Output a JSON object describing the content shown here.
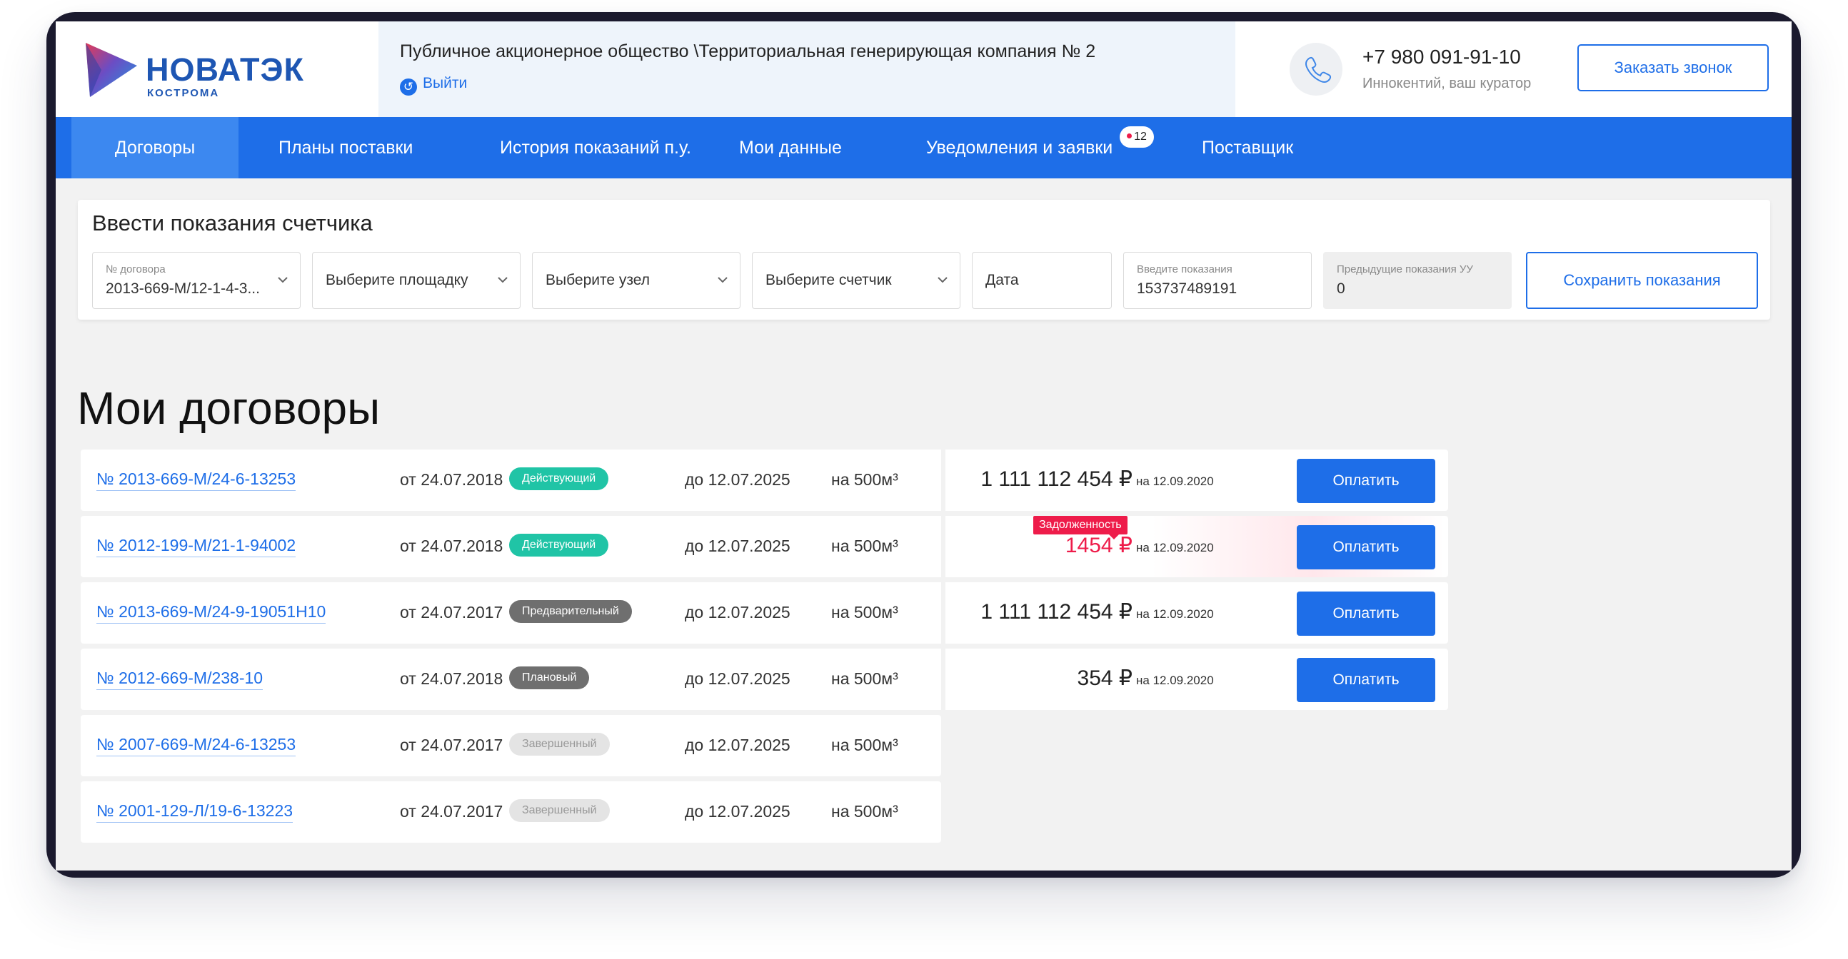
{
  "brand": {
    "name": "НОВАТЭК",
    "subtitle": "КОСТРОМА",
    "colors": {
      "primary": "#1e6ee8",
      "logo": "#1e56b3",
      "active_status": "#20c4a6",
      "debt": "#ee1c4a"
    }
  },
  "header": {
    "organization": "Публичное акционерное общество \\Территориальная генерирующая компания № 2",
    "logout_label": "Выйти",
    "phone": "+7 980 091-91-10",
    "curator": "Иннокентий, ваш куратор",
    "callback_button": "Заказать звонок"
  },
  "nav": {
    "items": [
      {
        "label": "Договоры"
      },
      {
        "label": "Планы поставки"
      },
      {
        "label": "История показаний п.у."
      },
      {
        "label": "Мои данные"
      },
      {
        "label": "Уведомления и заявки"
      },
      {
        "label": "Поставщик"
      }
    ],
    "active_index": 0,
    "notifications_count": "12"
  },
  "readings_form": {
    "title": "Ввести показания счетчика",
    "contract_label": "№ договора",
    "contract_value": "2013-669-М/12-1-4-3...",
    "site_placeholder": "Выберите площадку",
    "node_placeholder": "Выберите узел",
    "meter_placeholder": "Выберите счетчик",
    "date_placeholder": "Дата",
    "reading_label": "Введите показания",
    "reading_value": "153737489191",
    "prev_label": "Предыдущие показания УУ",
    "prev_value": "0",
    "save_button": "Сохранить показания"
  },
  "contracts": {
    "title": "Мои договоры",
    "debt_label": "Задолженность",
    "pay_label": "Оплатить",
    "rows": [
      {
        "number": "№ 2013-669-М/24-6-13253",
        "from": "от 24.07.2018",
        "status": "Действующий",
        "status_type": "active",
        "to": "до 12.07.2025",
        "volume": "на 500м³",
        "amount": "1 111 112 454 ₽",
        "as_of": "на 12.09.2020"
      },
      {
        "number": "№ 2012-199-М/21-1-94002",
        "from": "от 24.07.2018",
        "status": "Действующий",
        "status_type": "active",
        "to": "до 12.07.2025",
        "volume": "на 500м³",
        "amount": "1454 ₽",
        "as_of": "на 12.09.2020",
        "debt": true
      },
      {
        "number": "№ 2013-669-М/24-9-19051Н10",
        "from": "от 24.07.2017",
        "status": "Предварительный",
        "status_type": "pre",
        "to": "до 12.07.2025",
        "volume": "на 500м³",
        "amount": "1 111 112 454 ₽",
        "as_of": "на 12.09.2020"
      },
      {
        "number": "№ 2012-669-М/238-10",
        "from": "от 24.07.2018",
        "status": "Плановый",
        "status_type": "plan",
        "to": "до 12.07.2025",
        "volume": "на 500м³",
        "amount": "354 ₽",
        "as_of": "на 12.09.2020"
      },
      {
        "number": "№ 2007-669-М/24-6-13253",
        "from": "от 24.07.2017",
        "status": "Завершенный",
        "status_type": "done",
        "to": "до 12.07.2025",
        "volume": "на 500м³"
      },
      {
        "number": "№ 2001-129-Л/19-6-13223",
        "from": "от 24.07.2017",
        "status": "Завершенный",
        "status_type": "done",
        "to": "до 12.07.2025",
        "volume": "на 500м³"
      }
    ]
  }
}
